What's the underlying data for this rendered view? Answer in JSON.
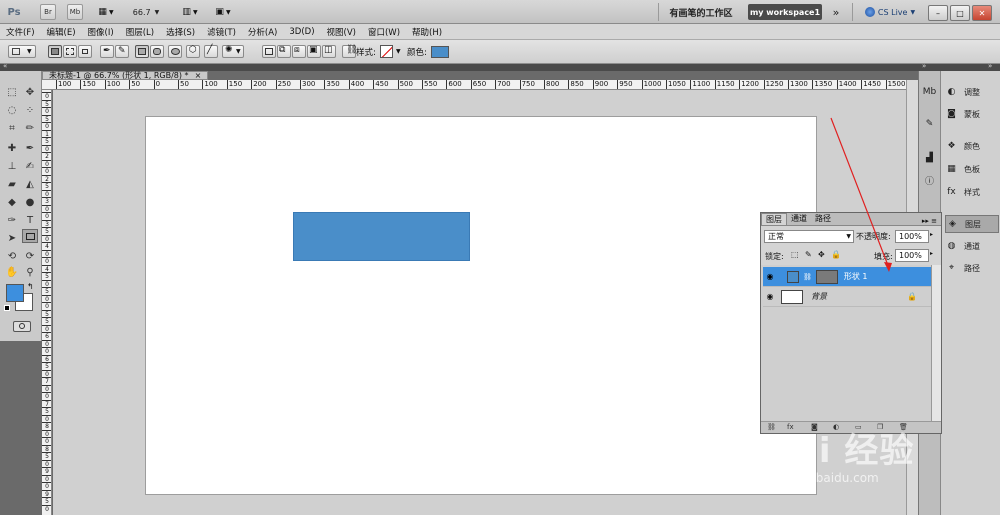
{
  "app_bar": {
    "logo": "Ps",
    "bridge": "Br",
    "minibridge": "Mb",
    "zoom": "66.7",
    "workspace_label": "有画笔的工作区",
    "active_workspace": "my workspace1",
    "more": "»",
    "cs_live": "CS Live",
    "minimize": "–",
    "restore": "□",
    "close": "✕"
  },
  "menu": [
    "文件(F)",
    "编辑(E)",
    "图像(I)",
    "图层(L)",
    "选择(S)",
    "滤镜(T)",
    "分析(A)",
    "3D(D)",
    "视图(V)",
    "窗口(W)",
    "帮助(H)"
  ],
  "options_bar": {
    "style_label": "样式:",
    "color_label": "颜色:",
    "shape_color": "#4a8ec9"
  },
  "document": {
    "tab_title": "未标题-1 @ 66.7% (形状 1, RGB/8) *",
    "tab_close": "×",
    "ruler_h": [
      "100",
      "150",
      "100",
      "50",
      "0",
      "50",
      "100",
      "150",
      "200",
      "250",
      "300",
      "350",
      "400",
      "450",
      "500",
      "550",
      "600",
      "650",
      "700",
      "750",
      "800",
      "850",
      "900",
      "950",
      "1000",
      "1050",
      "1100",
      "1150",
      "1200",
      "1250",
      "1300",
      "1350",
      "1400",
      "1450",
      "1500"
    ],
    "ruler_v": [
      "0",
      "5",
      "0",
      "5",
      "0",
      "1",
      "5",
      "0",
      "2",
      "0",
      "0",
      "2",
      "5",
      "0",
      "3",
      "0",
      "0",
      "3",
      "5",
      "0",
      "4",
      "0",
      "0",
      "4",
      "5",
      "0",
      "5",
      "0",
      "0",
      "5",
      "5",
      "0",
      "6",
      "0",
      "0",
      "6",
      "5",
      "0",
      "7",
      "0",
      "0",
      "7",
      "5",
      "0",
      "8",
      "0",
      "0",
      "8",
      "5",
      "0",
      "9",
      "0",
      "0",
      "9",
      "5",
      "0"
    ],
    "shape_fill": "#4a8ec9"
  },
  "toolbox": {
    "fg_color": "#3d8fde",
    "bg_color": "#ffffff"
  },
  "dock": {
    "col1_icons": [
      "mini-bridge-icon",
      "brush-preset-icon",
      "histogram-icon",
      "info-icon"
    ],
    "panels": [
      {
        "label": "调整",
        "icon": "adjustments-icon"
      },
      {
        "label": "蒙板",
        "icon": "masks-icon"
      },
      {
        "label": "颜色",
        "icon": "color-icon"
      },
      {
        "label": "色板",
        "icon": "swatches-icon"
      },
      {
        "label": "样式",
        "icon": "styles-icon"
      },
      {
        "label": "图层",
        "icon": "layers-icon"
      },
      {
        "label": "通道",
        "icon": "channels-icon"
      },
      {
        "label": "路径",
        "icon": "paths-icon"
      }
    ]
  },
  "layers_panel": {
    "tabs": [
      "图层",
      "通道",
      "路径"
    ],
    "blend_mode": "正常",
    "opacity_label": "不透明度:",
    "opacity": "100%",
    "lock_label": "锁定:",
    "fill_label": "填充:",
    "fill": "100%",
    "layers": [
      {
        "name": "形状 1",
        "selected": true
      },
      {
        "name": "背景",
        "selected": false
      }
    ]
  },
  "watermark": {
    "logo": "Bai 经验",
    "url": "jingyan.baidu.com"
  }
}
